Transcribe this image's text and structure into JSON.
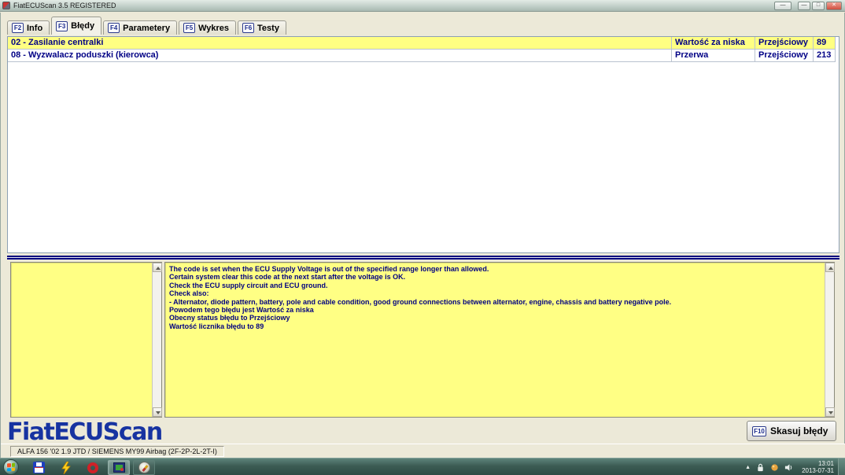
{
  "window": {
    "title": "FiatECUScan 3.5 REGISTERED"
  },
  "tabs": [
    {
      "key": "F2",
      "label": "Info"
    },
    {
      "key": "F3",
      "label": "Błędy"
    },
    {
      "key": "F4",
      "label": "Parametery"
    },
    {
      "key": "F5",
      "label": "Wykres"
    },
    {
      "key": "F6",
      "label": "Testy"
    }
  ],
  "errors_table": {
    "rows": [
      {
        "code": "02 - Zasilanie centralki",
        "reason": "Wartość za niska",
        "status": "Przejściowy",
        "count": "89"
      },
      {
        "code": "08 - Wyzwalacz poduszki (kierowca)",
        "reason": "Przerwa",
        "status": "Przejściowy",
        "count": "213"
      }
    ]
  },
  "details": {
    "lines": [
      "The code is set when the ECU Supply Voltage is out of the specified range longer than allowed.",
      "Certain system clear this code at the next start after the voltage is OK.",
      "Check the ECU supply circuit and ECU ground.",
      "Check also:",
      "- Alternator, diode pattern, battery, pole and cable condition, good ground connections between alternator, engine, chassis and battery negative pole.",
      "Powodem tego błędu jest Wartość za niska",
      "Obecny status błędu to Przejściowy",
      "Wartość licznika błędu to 89"
    ]
  },
  "logo_text": "FiatECUScan",
  "clear_button": {
    "key": "F10",
    "label": "Skasuj błędy"
  },
  "status_bar": {
    "vehicle": "ALFA 156 '02 1.9 JTD / SIEMENS MY99 Airbag (2F-2P-2L-2T-I)"
  },
  "taskbar": {
    "clock": {
      "time": "13:01",
      "date": "2013-07-31"
    },
    "icons": [
      "start",
      "file-manager",
      "lightning-app",
      "opera",
      "fiatecuscan-active",
      "compass-browser"
    ]
  },
  "colors": {
    "row_highlight": "#ffff82",
    "panel_yellow": "#ffff84",
    "text_navy": "#000080",
    "logo_blue": "#1733a1",
    "taskbar_teal": "#3c5c54"
  }
}
